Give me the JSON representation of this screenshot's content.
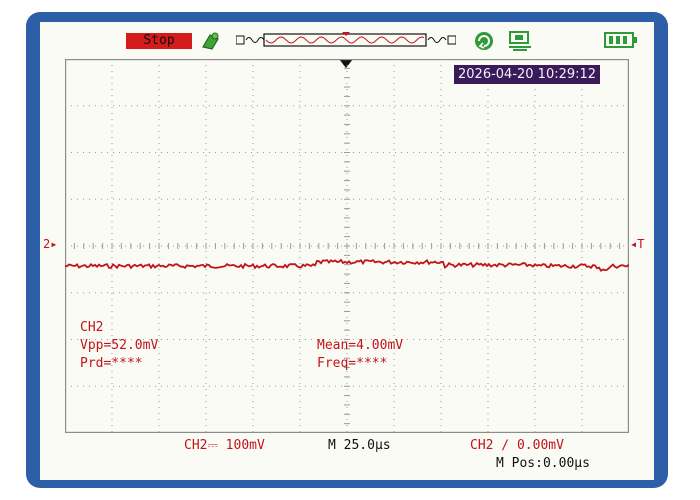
{
  "status": {
    "run_state": "Stop"
  },
  "datetime": "2026-04-20 10:29:12",
  "icons": {
    "run": "run-indicator-icon",
    "memory": "memory-depth-strip-icon",
    "trigger_status": "trigger-status-icon",
    "usb": "usb-icon",
    "battery": "battery-icon"
  },
  "markers": {
    "channel": "2",
    "trigger": "T"
  },
  "measurements": {
    "channel": "CH2",
    "vpp": "Vpp=52.0mV",
    "prd": "Prd=****",
    "mean": "Mean=4.00mV",
    "freq": "Freq=****"
  },
  "bottom": {
    "ch2_scale": "CH2⎓ 100mV",
    "timebase": "M 25.0μs",
    "trigger": "CH2 ∕ 0.00mV",
    "mpos": "M Pos:0.00μs"
  },
  "colors": {
    "trace": "#c0141a",
    "bezel": "#2d5fa8",
    "stop": "#d41c1c",
    "datetime_bg": "#3a1a59"
  }
}
